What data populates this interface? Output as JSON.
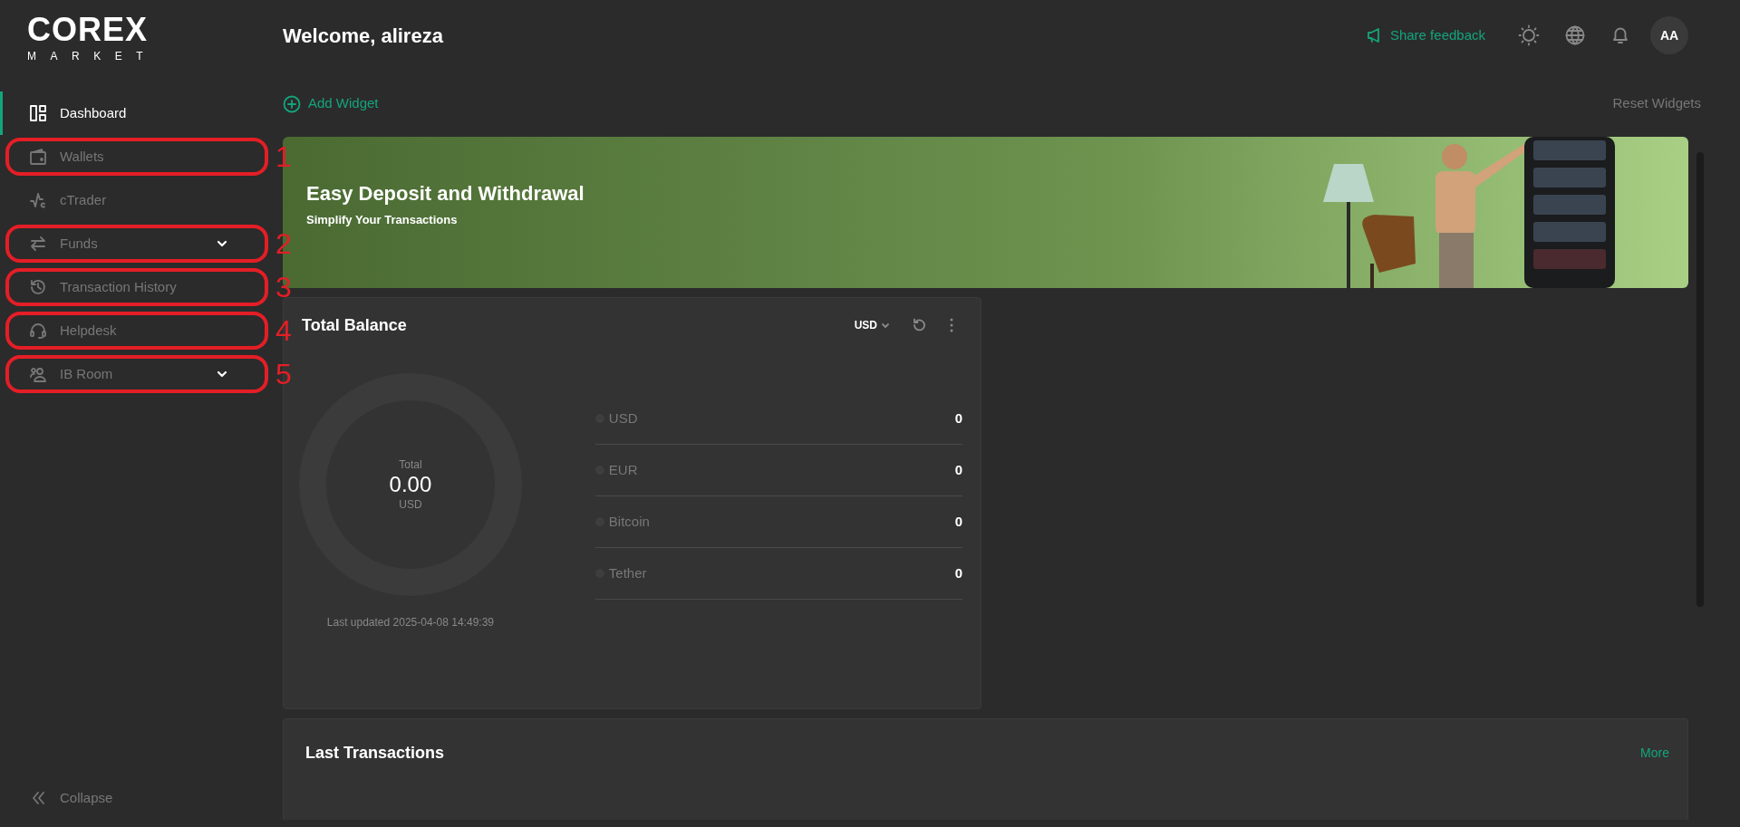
{
  "logo": {
    "wordmark": "COREX",
    "tagline": "MARKET"
  },
  "sidebar": {
    "items": [
      {
        "label": "Dashboard",
        "selected": true,
        "submenu": false
      },
      {
        "label": "Wallets",
        "selected": false,
        "submenu": false,
        "marker": "1"
      },
      {
        "label": "cTrader",
        "selected": false,
        "submenu": false
      },
      {
        "label": "Funds",
        "selected": false,
        "submenu": true,
        "marker": "2"
      },
      {
        "label": "Transaction History",
        "selected": false,
        "submenu": false,
        "marker": "3"
      },
      {
        "label": "Helpdesk",
        "selected": false,
        "submenu": false,
        "marker": "4"
      },
      {
        "label": "IB Room",
        "selected": false,
        "submenu": true,
        "marker": "5"
      }
    ],
    "collapse": "Collapse"
  },
  "header": {
    "welcome": "Welcome, alireza",
    "feedback": "Share feedback",
    "avatar": "AA"
  },
  "toolbar": {
    "add": "Add Widget",
    "reset": "Reset Widgets"
  },
  "banner": {
    "title": "Easy Deposit and Withdrawal",
    "subtitle": "Simplify Your Transactions"
  },
  "balance": {
    "title": "Total Balance",
    "currency": "USD",
    "total_label": "Total",
    "total": "0.00",
    "total_unit": "USD",
    "updated": "Last updated 2025-04-08 14:49:39",
    "assets": [
      {
        "name": "USD",
        "value": "0"
      },
      {
        "name": "EUR",
        "value": "0"
      },
      {
        "name": "Bitcoin",
        "value": "0"
      },
      {
        "name": "Tether",
        "value": "0"
      }
    ]
  },
  "transactions": {
    "title": "Last Transactions",
    "more": "More"
  }
}
